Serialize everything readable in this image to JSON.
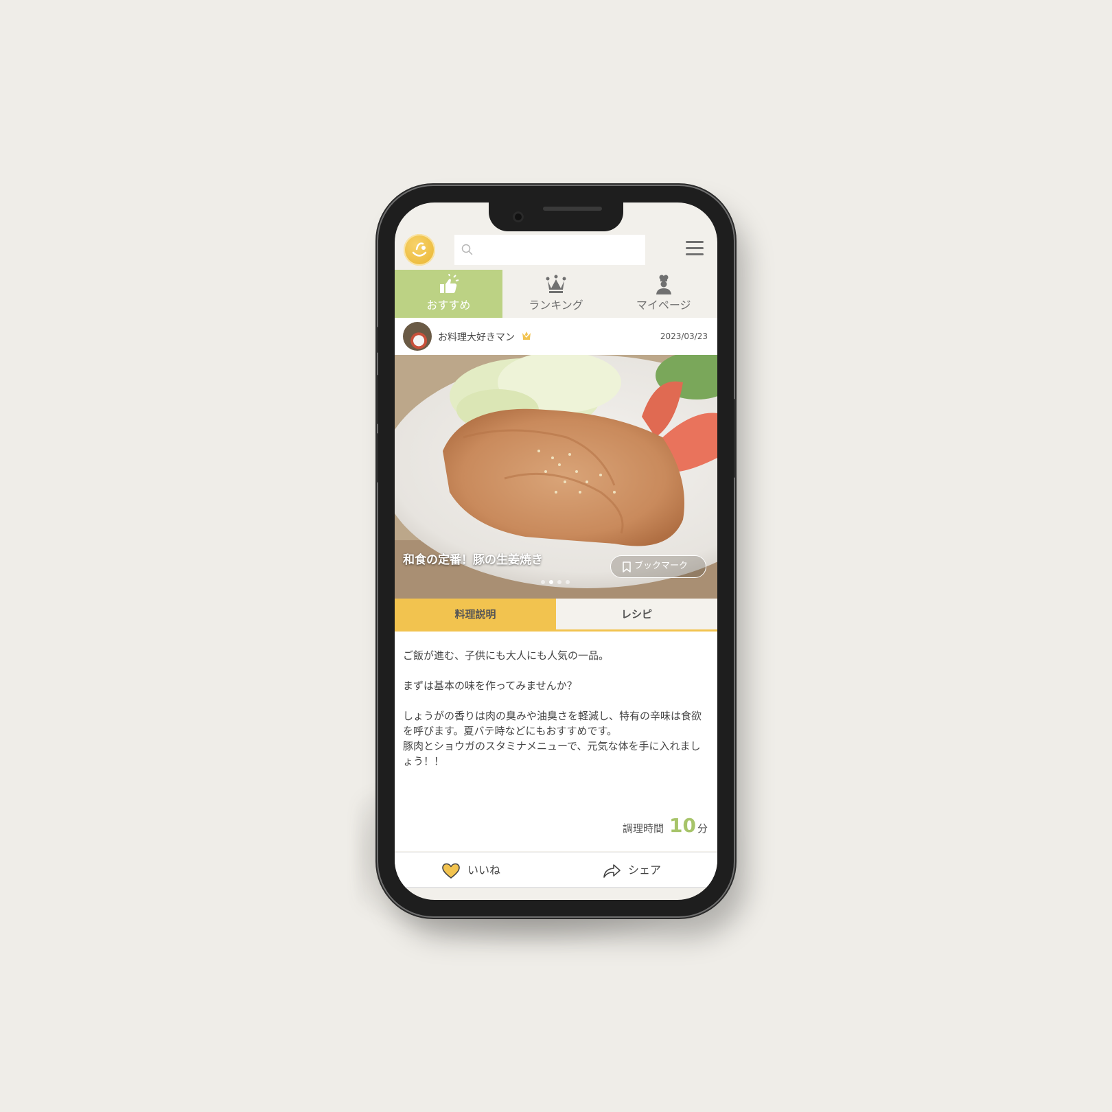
{
  "app": {
    "accent_green": "#bcd284",
    "accent_yellow": "#f2c34f"
  },
  "header": {
    "logo_icon": "chef-logo-icon",
    "search_placeholder": "",
    "menu_icon": "hamburger-menu-icon"
  },
  "nav": {
    "tabs": [
      {
        "label": "おすすめ",
        "icon": "thumbs-up-icon",
        "active": true
      },
      {
        "label": "ランキング",
        "icon": "crown-icon",
        "active": false
      },
      {
        "label": "マイページ",
        "icon": "chef-person-icon",
        "active": false
      }
    ]
  },
  "post": {
    "username": "お料理大好きマン",
    "badge_icon": "crown-badge-icon",
    "date": "2023/03/23",
    "title": "和食の定番！豚の生姜焼き",
    "bookmark_label": "ブックマーク",
    "carousel": {
      "count": 4,
      "active_index": 1
    }
  },
  "content_tabs": [
    {
      "label": "料理説明",
      "active": true
    },
    {
      "label": "レシピ",
      "active": false
    }
  ],
  "description": "ご飯が進む、子供にも大人にも人気の一品。\n\nまずは基本の味を作ってみませんか？\n\nしょうがの香りは肉の臭みや油臭さを軽減し、特有の辛味は食欲を呼びます。夏バテ時などにもおすすめです。\n豚肉とショウガのスタミナメニューで、元気な体を手に入れましょう！！",
  "cook_time": {
    "label": "調理時間",
    "value": "10",
    "unit": "分"
  },
  "actions": {
    "like_label": "いいね",
    "share_label": "シェア"
  }
}
